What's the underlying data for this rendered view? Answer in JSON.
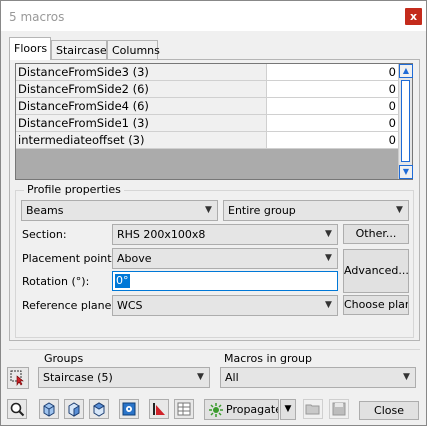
{
  "window": {
    "title": "5 macros",
    "close_glyph": "x"
  },
  "tabs": [
    {
      "label": "Floors",
      "active": true
    },
    {
      "label": "Staircase",
      "active": false
    },
    {
      "label": "Columns",
      "active": false
    }
  ],
  "grid": {
    "rows": [
      {
        "name": "DistanceFromSide3 (3)",
        "value": "0"
      },
      {
        "name": "DistanceFromSide2 (6)",
        "value": "0"
      },
      {
        "name": "DistanceFromSide4 (6)",
        "value": "0"
      },
      {
        "name": "DistanceFromSide1 (3)",
        "value": "0"
      },
      {
        "name": "intermediateoffset (3)",
        "value": "0"
      }
    ]
  },
  "profile": {
    "group_label": "Profile properties",
    "type_value": "Beams",
    "scope_value": "Entire group",
    "section_label": "Section:",
    "section_value": "RHS 200x100x8",
    "other_button": "Other...",
    "placement_label": "Placement point:",
    "placement_value": "Above",
    "rotation_label": "Rotation (°):",
    "rotation_value": "0°",
    "advanced_button": "Advanced...",
    "reference_label": "Reference plane",
    "reference_value": "WCS",
    "choose_plane_button": "Choose plane"
  },
  "groups": {
    "label": "Groups",
    "value": "Staircase (5)"
  },
  "macros_in_group": {
    "label": "Macros in group",
    "value": "All"
  },
  "toolbar": {
    "propagate_label": "Propagate",
    "close_label": "Close"
  },
  "colors": {
    "accent": "#0078d7",
    "close_red": "#c42b1c",
    "red_icon": "#d0232a"
  }
}
